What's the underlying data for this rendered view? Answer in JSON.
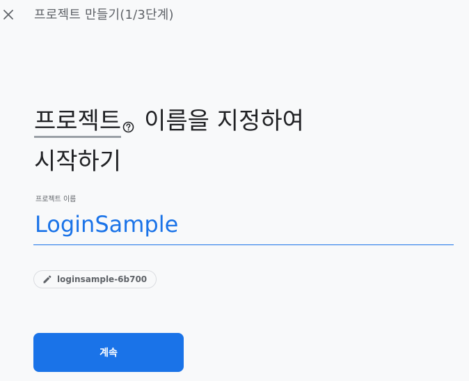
{
  "header": {
    "close_icon": "close-icon",
    "title": "프로젝트 만들기(1/3단계)"
  },
  "heading": {
    "term": "프로젝트",
    "help_icon": "help-circle-icon",
    "rest_line1": "이름을 지정하여",
    "line2": "시작하기"
  },
  "project_name": {
    "label": "프로젝트 이름",
    "value": "LoginSample"
  },
  "project_id_chip": {
    "icon": "pencil-icon",
    "text": "loginsample-6b700"
  },
  "continue_button": {
    "label": "계속"
  },
  "colors": {
    "accent": "#1a73e8",
    "background": "#f8f9fa",
    "text_primary": "#202124",
    "text_secondary": "#5f6368"
  }
}
